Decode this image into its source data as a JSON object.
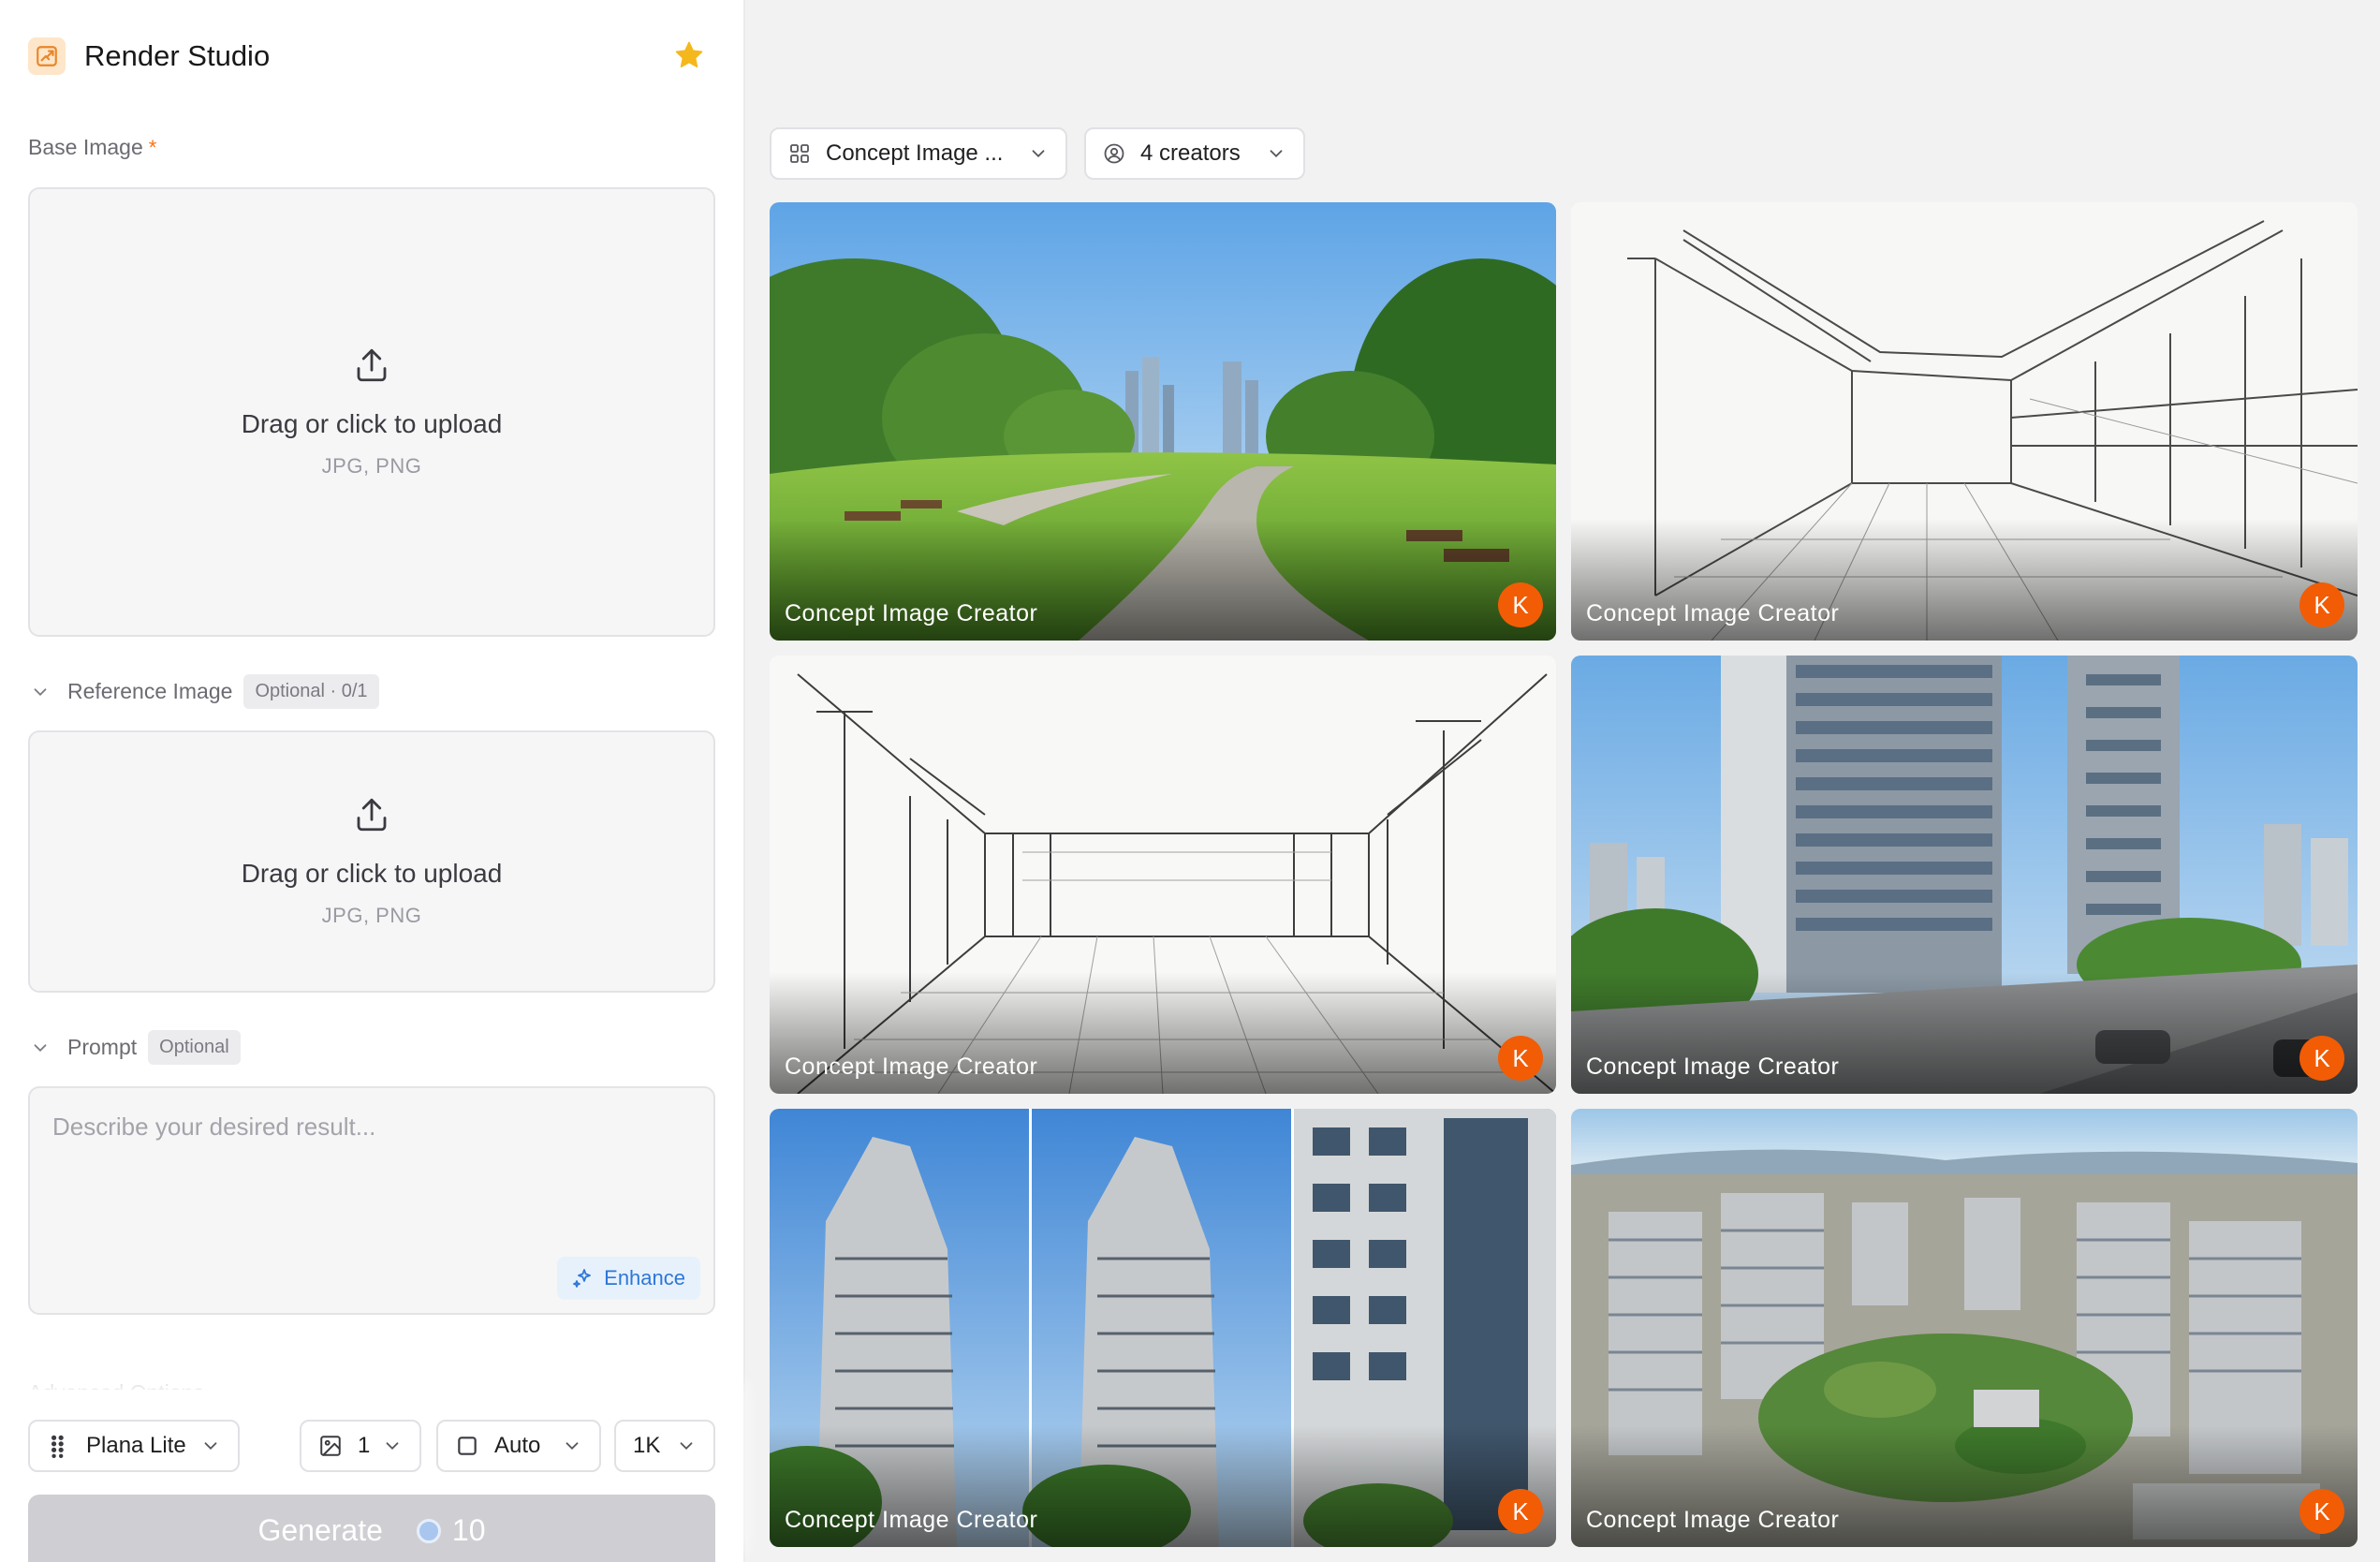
{
  "app": {
    "title": "Render Studio"
  },
  "base_image": {
    "label": "Base Image",
    "required_mark": "*",
    "upload_title": "Drag or click to upload",
    "upload_formats": "JPG, PNG"
  },
  "reference_image": {
    "label": "Reference Image",
    "badge": "Optional · 0/1",
    "upload_title": "Drag or click to upload",
    "upload_formats": "JPG, PNG"
  },
  "prompt": {
    "label": "Prompt",
    "badge": "Optional",
    "placeholder": "Describe your desired result...",
    "enhance_label": "Enhance"
  },
  "advanced": {
    "label": "Advanced Options"
  },
  "controls": {
    "model": "Plana Lite",
    "count": "1",
    "aspect": "Auto",
    "resolution": "1K"
  },
  "generate": {
    "label": "Generate",
    "cost": "10"
  },
  "filters": {
    "category": "Concept Image ...",
    "creators": "4 creators"
  },
  "gallery": [
    {
      "caption": "Concept Image Creator",
      "avatar": "K",
      "scene": "park"
    },
    {
      "caption": "Concept Image Creator",
      "avatar": "K",
      "scene": "sketch-interior"
    },
    {
      "caption": "Concept Image Creator",
      "avatar": "K",
      "scene": "sketch-hall"
    },
    {
      "caption": "Concept Image Creator",
      "avatar": "K",
      "scene": "tower-street"
    },
    {
      "caption": "Concept Image Creator",
      "avatar": "K",
      "scene": "tower-triptych"
    },
    {
      "caption": "Concept Image Creator",
      "avatar": "K",
      "scene": "aerial-city"
    }
  ],
  "colors": {
    "accent": "#f25c05",
    "brand_icon_bg": "#fde6c9",
    "enhance": "#2d77d8",
    "generate_disabled": "#cfcfd3",
    "star": "#f5b81c"
  }
}
